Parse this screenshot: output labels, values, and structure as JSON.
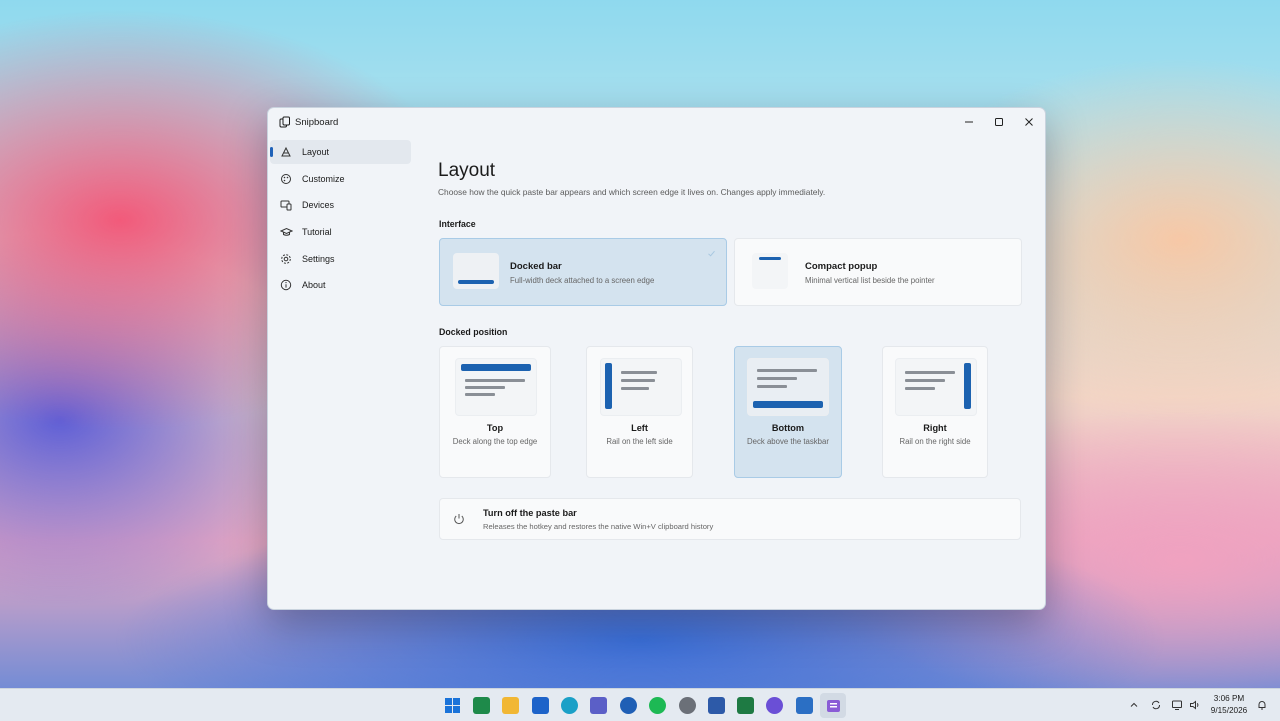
{
  "window": {
    "app_title": "Snipboard",
    "controls": {
      "minimize_icon": "minimize-icon",
      "maximize_icon": "maximize-icon",
      "close_icon": "close-icon"
    }
  },
  "sidebar": {
    "items": [
      {
        "label": "Layout",
        "icon": "layout-icon",
        "active": true
      },
      {
        "label": "Customize",
        "icon": "palette-icon",
        "active": false
      },
      {
        "label": "Devices",
        "icon": "devices-icon",
        "active": false
      },
      {
        "label": "Tutorial",
        "icon": "graduation-cap-icon",
        "active": false
      },
      {
        "label": "Settings",
        "icon": "gear-icon",
        "active": false
      },
      {
        "label": "About",
        "icon": "info-icon",
        "active": false
      }
    ]
  },
  "main": {
    "title": "Layout",
    "subtitle": "Choose how the quick paste bar appears and which screen edge it lives on. Changes apply immediately.",
    "interface": {
      "section_label": "Interface",
      "options": [
        {
          "title": "Docked bar",
          "description": "Full-width deck attached to a screen edge",
          "selected": true
        },
        {
          "title": "Compact popup",
          "description": "Minimal vertical list beside the pointer",
          "selected": false
        }
      ]
    },
    "docked_position": {
      "section_label": "Docked position",
      "options": [
        {
          "title": "Top",
          "description": "Deck along the top edge",
          "selected": false
        },
        {
          "title": "Left",
          "description": "Rail on the left side",
          "selected": false
        },
        {
          "title": "Bottom",
          "description": "Deck above the taskbar",
          "selected": true
        },
        {
          "title": "Right",
          "description": "Rail on the right side",
          "selected": false
        }
      ]
    },
    "toggle": {
      "title": "Turn off the paste bar",
      "description": "Releases the hotkey and restores the native Win+V clipboard history",
      "icon": "power-icon"
    }
  },
  "taskbar": {
    "time": "3:06 PM",
    "date": "9/15/2026",
    "accent_color": "#1c62b0"
  }
}
